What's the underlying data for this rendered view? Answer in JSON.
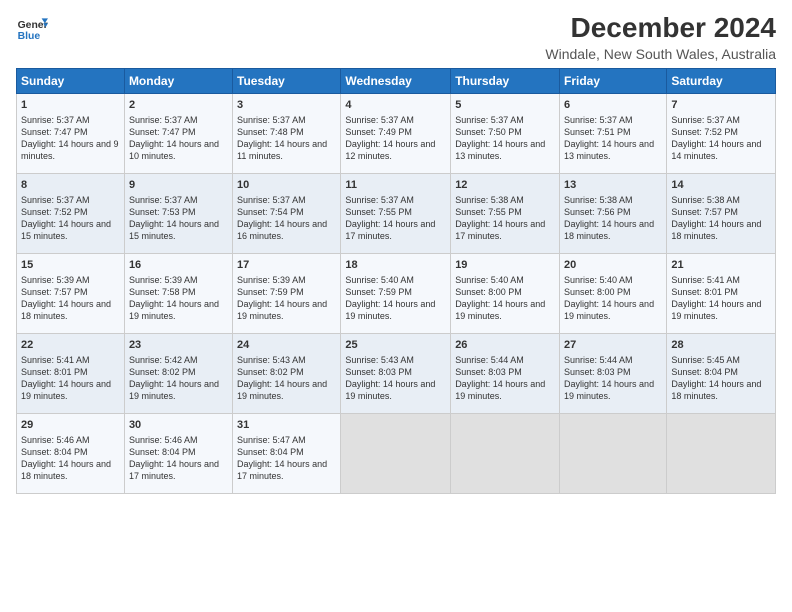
{
  "logo": {
    "line1": "General",
    "line2": "Blue"
  },
  "title": "December 2024",
  "subtitle": "Windale, New South Wales, Australia",
  "weekdays": [
    "Sunday",
    "Monday",
    "Tuesday",
    "Wednesday",
    "Thursday",
    "Friday",
    "Saturday"
  ],
  "weeks": [
    [
      {
        "day": 1,
        "sunrise": "5:37 AM",
        "sunset": "7:47 PM",
        "daylight": "14 hours and 9 minutes."
      },
      {
        "day": 2,
        "sunrise": "5:37 AM",
        "sunset": "7:47 PM",
        "daylight": "14 hours and 10 minutes."
      },
      {
        "day": 3,
        "sunrise": "5:37 AM",
        "sunset": "7:48 PM",
        "daylight": "14 hours and 11 minutes."
      },
      {
        "day": 4,
        "sunrise": "5:37 AM",
        "sunset": "7:49 PM",
        "daylight": "14 hours and 12 minutes."
      },
      {
        "day": 5,
        "sunrise": "5:37 AM",
        "sunset": "7:50 PM",
        "daylight": "14 hours and 13 minutes."
      },
      {
        "day": 6,
        "sunrise": "5:37 AM",
        "sunset": "7:51 PM",
        "daylight": "14 hours and 13 minutes."
      },
      {
        "day": 7,
        "sunrise": "5:37 AM",
        "sunset": "7:52 PM",
        "daylight": "14 hours and 14 minutes."
      }
    ],
    [
      {
        "day": 8,
        "sunrise": "5:37 AM",
        "sunset": "7:52 PM",
        "daylight": "14 hours and 15 minutes."
      },
      {
        "day": 9,
        "sunrise": "5:37 AM",
        "sunset": "7:53 PM",
        "daylight": "14 hours and 15 minutes."
      },
      {
        "day": 10,
        "sunrise": "5:37 AM",
        "sunset": "7:54 PM",
        "daylight": "14 hours and 16 minutes."
      },
      {
        "day": 11,
        "sunrise": "5:37 AM",
        "sunset": "7:55 PM",
        "daylight": "14 hours and 17 minutes."
      },
      {
        "day": 12,
        "sunrise": "5:38 AM",
        "sunset": "7:55 PM",
        "daylight": "14 hours and 17 minutes."
      },
      {
        "day": 13,
        "sunrise": "5:38 AM",
        "sunset": "7:56 PM",
        "daylight": "14 hours and 18 minutes."
      },
      {
        "day": 14,
        "sunrise": "5:38 AM",
        "sunset": "7:57 PM",
        "daylight": "14 hours and 18 minutes."
      }
    ],
    [
      {
        "day": 15,
        "sunrise": "5:39 AM",
        "sunset": "7:57 PM",
        "daylight": "14 hours and 18 minutes."
      },
      {
        "day": 16,
        "sunrise": "5:39 AM",
        "sunset": "7:58 PM",
        "daylight": "14 hours and 19 minutes."
      },
      {
        "day": 17,
        "sunrise": "5:39 AM",
        "sunset": "7:59 PM",
        "daylight": "14 hours and 19 minutes."
      },
      {
        "day": 18,
        "sunrise": "5:40 AM",
        "sunset": "7:59 PM",
        "daylight": "14 hours and 19 minutes."
      },
      {
        "day": 19,
        "sunrise": "5:40 AM",
        "sunset": "8:00 PM",
        "daylight": "14 hours and 19 minutes."
      },
      {
        "day": 20,
        "sunrise": "5:40 AM",
        "sunset": "8:00 PM",
        "daylight": "14 hours and 19 minutes."
      },
      {
        "day": 21,
        "sunrise": "5:41 AM",
        "sunset": "8:01 PM",
        "daylight": "14 hours and 19 minutes."
      }
    ],
    [
      {
        "day": 22,
        "sunrise": "5:41 AM",
        "sunset": "8:01 PM",
        "daylight": "14 hours and 19 minutes."
      },
      {
        "day": 23,
        "sunrise": "5:42 AM",
        "sunset": "8:02 PM",
        "daylight": "14 hours and 19 minutes."
      },
      {
        "day": 24,
        "sunrise": "5:43 AM",
        "sunset": "8:02 PM",
        "daylight": "14 hours and 19 minutes."
      },
      {
        "day": 25,
        "sunrise": "5:43 AM",
        "sunset": "8:03 PM",
        "daylight": "14 hours and 19 minutes."
      },
      {
        "day": 26,
        "sunrise": "5:44 AM",
        "sunset": "8:03 PM",
        "daylight": "14 hours and 19 minutes."
      },
      {
        "day": 27,
        "sunrise": "5:44 AM",
        "sunset": "8:03 PM",
        "daylight": "14 hours and 19 minutes."
      },
      {
        "day": 28,
        "sunrise": "5:45 AM",
        "sunset": "8:04 PM",
        "daylight": "14 hours and 18 minutes."
      }
    ],
    [
      {
        "day": 29,
        "sunrise": "5:46 AM",
        "sunset": "8:04 PM",
        "daylight": "14 hours and 18 minutes."
      },
      {
        "day": 30,
        "sunrise": "5:46 AM",
        "sunset": "8:04 PM",
        "daylight": "14 hours and 17 minutes."
      },
      {
        "day": 31,
        "sunrise": "5:47 AM",
        "sunset": "8:04 PM",
        "daylight": "14 hours and 17 minutes."
      },
      null,
      null,
      null,
      null
    ]
  ]
}
